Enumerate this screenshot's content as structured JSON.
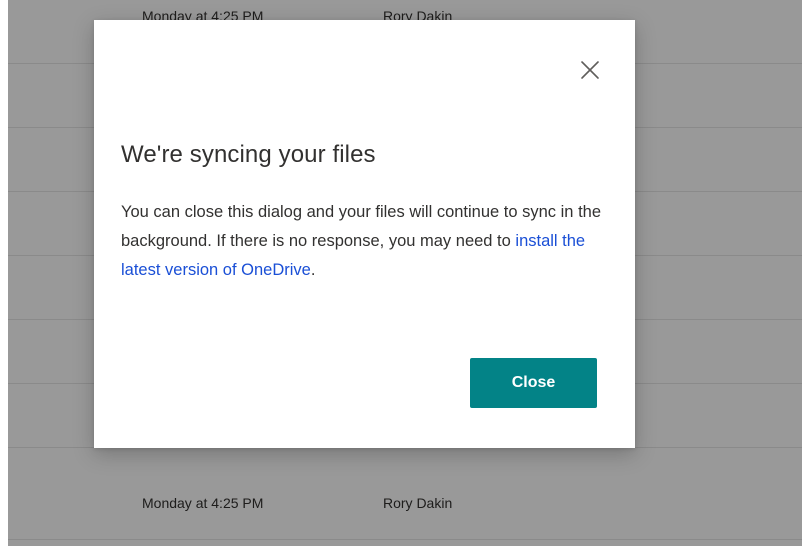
{
  "background_list": {
    "rows": [
      {
        "modified": "Monday at 4:25 PM",
        "modified_by": "Rory Dakin"
      },
      {
        "modified": "Monday at 4:25 PM",
        "modified_by": "Rory Dakin"
      }
    ]
  },
  "dialog": {
    "title": "We're syncing your files",
    "body_text": "You can close this dialog and your files will continue to sync in the background. If there is no response, you may need to ",
    "link_text": "install the latest version of OneDrive",
    "body_end": ".",
    "close_button_label": "Close",
    "close_icon": "close-icon",
    "accent_color": "#038387",
    "link_color": "#1a4fd6"
  }
}
